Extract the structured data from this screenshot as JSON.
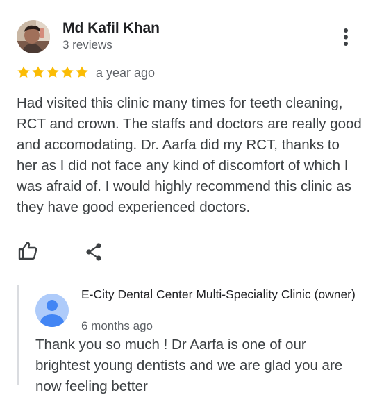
{
  "review": {
    "reviewer_name": "Md Kafil Khan",
    "reviewer_reviews": "3 reviews",
    "rating": 5,
    "rating_max": 5,
    "time": "a year ago",
    "text": "Had visited this clinic many times for teeth cleaning, RCT and crown. The staffs and doctors are really good and accomodating. Dr. Aarfa did my RCT, thanks to her as I did not face any kind of discomfort of which I was afraid of. I would highly recommend this clinic as they have good experienced doctors."
  },
  "owner_response": {
    "name": "E-City Dental Center Multi-Speciality Clinic (owner)",
    "time": "6 months ago",
    "text": "Thank you so much ! Dr Aarfa is one of our brightest young dentists and we are glad you are now feeling better"
  },
  "icons": {
    "more": "more-vert-icon",
    "like": "thumb-up-icon",
    "share": "share-icon",
    "star": "star-icon",
    "owner_avatar": "default-person-icon"
  },
  "colors": {
    "star": "#fbbc04",
    "owner_avatar_bg": "#aecbfa",
    "owner_avatar_fg": "#4285f4",
    "secondary_text": "#5f6368",
    "body_text": "#3c4043"
  }
}
